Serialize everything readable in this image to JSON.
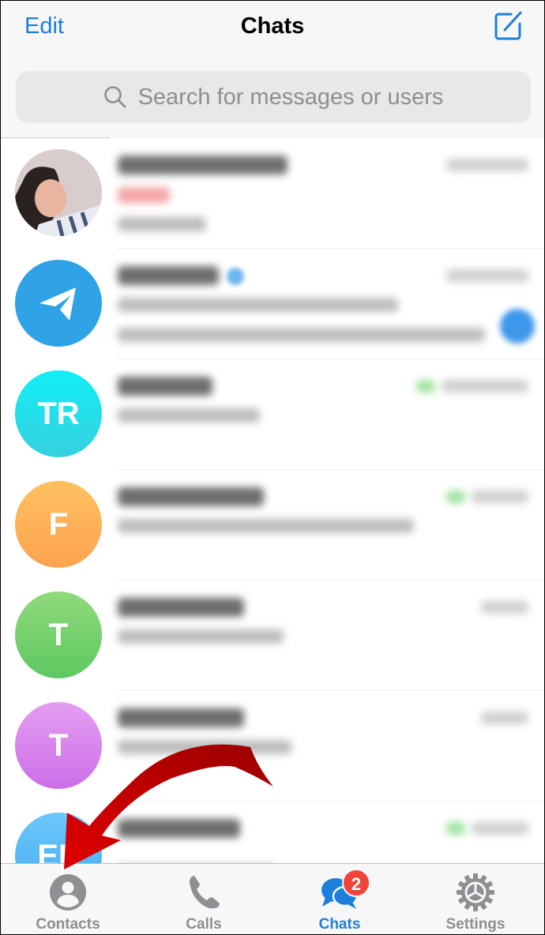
{
  "header": {
    "edit_label": "Edit",
    "title": "Chats",
    "compose_icon": "compose-icon"
  },
  "search": {
    "placeholder": "Search for messages or users",
    "icon": "search-icon"
  },
  "chats": [
    {
      "avatar_type": "photo",
      "initials": "",
      "color_top": "#d9cccc",
      "color_bottom": "#cfc3c4",
      "obscured": true,
      "has_draft": true,
      "unread": false,
      "read_check": false,
      "verified": false
    },
    {
      "avatar_type": "telegram-logo",
      "initials": "",
      "color_top": "#2fa3e6",
      "color_bottom": "#2fa3e6",
      "obscured": true,
      "has_draft": false,
      "unread": true,
      "read_check": false,
      "verified": true
    },
    {
      "avatar_type": "initials",
      "initials": "TR",
      "color_top": "#12eef6",
      "color_bottom": "#37d0de",
      "obscured": true,
      "has_draft": false,
      "unread": false,
      "read_check": true,
      "verified": false
    },
    {
      "avatar_type": "initials",
      "initials": "F",
      "color_top": "#ffc060",
      "color_bottom": "#fda350",
      "obscured": true,
      "has_draft": false,
      "unread": false,
      "read_check": true,
      "verified": false
    },
    {
      "avatar_type": "initials",
      "initials": "T",
      "color_top": "#8fda7c",
      "color_bottom": "#5ec861",
      "obscured": true,
      "has_draft": false,
      "unread": false,
      "read_check": false,
      "verified": false
    },
    {
      "avatar_type": "initials",
      "initials": "T",
      "color_top": "#e49ef2",
      "color_bottom": "#cc6ee8",
      "obscured": true,
      "has_draft": false,
      "unread": false,
      "read_check": false,
      "verified": false
    },
    {
      "avatar_type": "initials",
      "initials": "EE",
      "color_top": "#6cc8fa",
      "color_bottom": "#42aaf0",
      "obscured": true,
      "has_draft": false,
      "unread": false,
      "read_check": true,
      "verified": false
    }
  ],
  "tabbar": {
    "tabs": [
      {
        "label": "Contacts",
        "icon": "contacts-icon",
        "active": false
      },
      {
        "label": "Calls",
        "icon": "calls-icon",
        "active": false
      },
      {
        "label": "Chats",
        "icon": "chats-icon",
        "active": true,
        "badge": "2"
      },
      {
        "label": "Settings",
        "icon": "settings-icon",
        "active": false
      }
    ]
  },
  "annotation": {
    "type": "arrow",
    "color": "#d40000",
    "points_to": "Contacts"
  },
  "colors": {
    "accent": "#1c7fdc",
    "badge": "#f0443a",
    "inactive": "#8e8e93"
  }
}
